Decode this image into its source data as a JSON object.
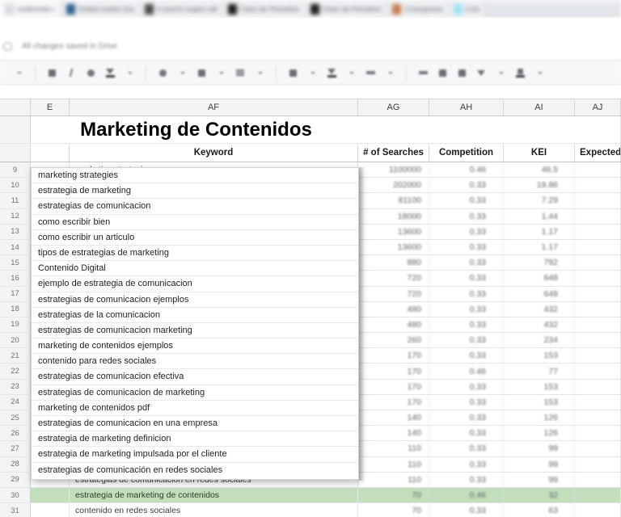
{
  "browser": {
    "tabs": [
      {
        "label": "multimedia c",
        "favicon_color": "#d8dade"
      },
      {
        "label": "Global market sha",
        "favicon_color": "#2c5f8a"
      },
      {
        "label": "A search engine will",
        "favicon_color": "#4a4a4a"
      },
      {
        "label": "Clase de Periodism",
        "favicon_color": "#1b1b1b"
      },
      {
        "label": "Clase de Periodism",
        "favicon_color": "#1b1b1b"
      },
      {
        "label": "Cronograma",
        "favicon_color": "#c8794a"
      },
      {
        "label": "Cont",
        "favicon_color": "#9fe2f5"
      }
    ]
  },
  "docs": {
    "save_status": "All changes saved in Drive",
    "save_icon": "cloud-saved-icon"
  },
  "toolbar": {
    "groups": [
      {
        "name": "text-format",
        "items": [
          {
            "name": "font-size-caret-icon",
            "glyph": "caret"
          },
          {
            "name": "bold-icon",
            "glyph": "square"
          },
          {
            "name": "italic-icon",
            "glyph": "italic"
          },
          {
            "name": "strikethrough-icon",
            "glyph": "circle"
          },
          {
            "name": "text-color-icon",
            "glyph": "text-color"
          }
        ]
      },
      {
        "name": "cell-format",
        "items": [
          {
            "name": "fill-color-icon",
            "glyph": "circle"
          },
          {
            "name": "borders-icon",
            "glyph": "grid"
          },
          {
            "name": "merge-cells-icon",
            "glyph": "lines"
          }
        ]
      },
      {
        "name": "alignment",
        "items": [
          {
            "name": "horizontal-align-icon",
            "glyph": "square"
          },
          {
            "name": "vertical-align-icon",
            "glyph": "text-color"
          },
          {
            "name": "text-wrapping-icon",
            "glyph": "dash"
          }
        ]
      },
      {
        "name": "insert",
        "items": [
          {
            "name": "insert-link-icon",
            "glyph": "dash"
          },
          {
            "name": "insert-comment-icon",
            "glyph": "square"
          },
          {
            "name": "insert-chart-icon",
            "glyph": "chart"
          },
          {
            "name": "create-filter-icon",
            "glyph": "triangle"
          },
          {
            "name": "functions-icon",
            "glyph": "text-color"
          }
        ]
      }
    ]
  },
  "sheet": {
    "column_headers": [
      "E",
      "AF",
      "AG",
      "AH",
      "AI",
      "AJ"
    ],
    "title": "Marketing de Contenidos",
    "table_headers": {
      "keyword": "Keyword",
      "searches": "# of Searches",
      "competition": "Competition",
      "kei": "KEI",
      "expected": "Expected"
    },
    "rows": [
      {
        "num": "9",
        "keyword": "marketing strategies",
        "searches": "1100000",
        "competition": "0.46",
        "kei": "48.5"
      },
      {
        "num": "10",
        "keyword": "estrategia de marketing",
        "searches": "202000",
        "competition": "0.33",
        "kei": "19.86"
      },
      {
        "num": "11",
        "keyword": "estrategias de comunicacion",
        "searches": "81100",
        "competition": "0.33",
        "kei": "7.29"
      },
      {
        "num": "12",
        "keyword": "como escribir bien",
        "searches": "18000",
        "competition": "0.33",
        "kei": "1.44"
      },
      {
        "num": "13",
        "keyword": "como escribir un articulo",
        "searches": "13600",
        "competition": "0.33",
        "kei": "1.17"
      },
      {
        "num": "14",
        "keyword": "tipos de estrategias de marketing",
        "searches": "13600",
        "competition": "0.33",
        "kei": "1.17"
      },
      {
        "num": "15",
        "keyword": "Contenido Digital",
        "searches": "880",
        "competition": "0.33",
        "kei": "792"
      },
      {
        "num": "16",
        "keyword": "ejemplo de estrategia de comunicacion",
        "searches": "720",
        "competition": "0.33",
        "kei": "648"
      },
      {
        "num": "17",
        "keyword": "estrategias de comunicacion ejemplos",
        "searches": "720",
        "competition": "0.33",
        "kei": "648"
      },
      {
        "num": "18",
        "keyword": "estrategias de la comunicacion",
        "searches": "480",
        "competition": "0.33",
        "kei": "432"
      },
      {
        "num": "19",
        "keyword": "estrategias de comunicacion marketing",
        "searches": "480",
        "competition": "0.33",
        "kei": "432"
      },
      {
        "num": "20",
        "keyword": "marketing de contenidos ejemplos",
        "searches": "260",
        "competition": "0.33",
        "kei": "234"
      },
      {
        "num": "21",
        "keyword": "contenido para redes sociales",
        "searches": "170",
        "competition": "0.33",
        "kei": "153"
      },
      {
        "num": "22",
        "keyword": "estrategias de comunicacion efectiva",
        "searches": "170",
        "competition": "0.46",
        "kei": "77"
      },
      {
        "num": "23",
        "keyword": "estrategias de comunicacion de marketing",
        "searches": "170",
        "competition": "0.33",
        "kei": "153"
      },
      {
        "num": "24",
        "keyword": "marketing de contenidos pdf",
        "searches": "170",
        "competition": "0.33",
        "kei": "153"
      },
      {
        "num": "25",
        "keyword": "estrategias de comunicacion en una empresa",
        "searches": "140",
        "competition": "0.33",
        "kei": "126"
      },
      {
        "num": "26",
        "keyword": "estrategia de marketing definicion",
        "searches": "140",
        "competition": "0.33",
        "kei": "126"
      },
      {
        "num": "27",
        "keyword": "estrategia de marketing impulsada por el cliente",
        "searches": "110",
        "competition": "0.33",
        "kei": "99"
      },
      {
        "num": "28",
        "keyword": "estrategias de comunicación en redes sociales",
        "searches": "110",
        "competition": "0.33",
        "kei": "99"
      },
      {
        "num": "29",
        "keyword": "estrategias de comunicación en redes sociales",
        "searches": "110",
        "competition": "0.33",
        "kei": "99"
      },
      {
        "num": "30",
        "keyword": "estrategia de marketing de contenidos",
        "searches": "70",
        "competition": "0.46",
        "kei": "32",
        "highlight": "#c3debc"
      },
      {
        "num": "31",
        "keyword": "contenido en redes sociales",
        "searches": "70",
        "competition": "0.33",
        "kei": "63"
      }
    ]
  },
  "suggestions": {
    "name": "keyword-autocomplete-overlay",
    "items": [
      "marketing strategies",
      "estrategia de marketing",
      "estrategias de comunicacion",
      "como escribir bien",
      "como escribir un articulo",
      "tipos de estrategias de marketing",
      "Contenido Digital",
      "ejemplo de estrategia de comunicacion",
      "estrategias de comunicacion ejemplos",
      "estrategias de la comunicacion",
      "estrategias de comunicacion marketing",
      "marketing de contenidos ejemplos",
      "contenido para redes sociales",
      "estrategias de comunicacion efectiva",
      "estrategias de comunicacion de marketing",
      "marketing de contenidos pdf",
      "estrategias de comunicacion en una empresa",
      "estrategia de marketing definicion",
      "estrategia de marketing impulsada por el cliente",
      "estrategias de comunicación en redes sociales"
    ]
  },
  "colors": {
    "highlight_green": "#c3debc",
    "header_gray": "#f1f3f4",
    "grid_line": "#e4e6e8"
  }
}
